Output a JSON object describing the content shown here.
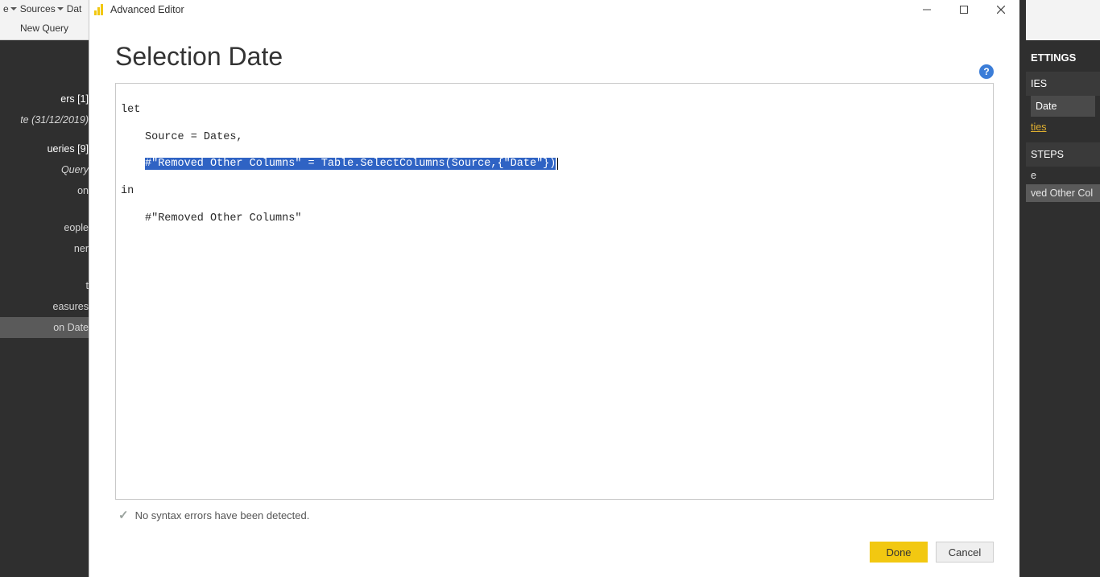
{
  "bg_left": {
    "ribbon": {
      "label_e": "e",
      "label_sources": "Sources",
      "label_data": "Dat",
      "new_query": "New Query"
    },
    "groups": [
      {
        "header": "ers [1]",
        "items": [
          {
            "text": "te (31/12/2019)",
            "style": "italic"
          }
        ]
      },
      {
        "header": "ueries [9]",
        "items": [
          {
            "text": "Query",
            "style": "italic"
          },
          {
            "text": "on",
            "style": "normal"
          },
          {
            "text": "",
            "style": "gap"
          },
          {
            "text": "eople",
            "style": "normal"
          },
          {
            "text": "ner",
            "style": "normal"
          },
          {
            "text": "",
            "style": "gap"
          },
          {
            "text": "t",
            "style": "normal"
          },
          {
            "text": "easures",
            "style": "normal"
          },
          {
            "text": "on Date",
            "style": "selected"
          }
        ]
      }
    ]
  },
  "bg_right": {
    "settings_header": "ETTINGS",
    "properties_header": "IES",
    "name_value": "Date",
    "all_props_link": "ties",
    "applied_header": "STEPS",
    "steps": [
      {
        "text": "e",
        "selected": false
      },
      {
        "text": "ved Other Col",
        "selected": true
      }
    ]
  },
  "dialog": {
    "window_title": "Advanced Editor",
    "heading": "Selection Date",
    "help_glyph": "?",
    "code": {
      "line1": "let",
      "line2": "Source = Dates,",
      "line3_sel": "#\"Removed Other Columns\" = Table.SelectColumns(Source,{\"Date\"})",
      "line4": "in",
      "line5": "#\"Removed Other Columns\""
    },
    "status_text": "No syntax errors have been detected.",
    "done_label": "Done",
    "cancel_label": "Cancel"
  }
}
